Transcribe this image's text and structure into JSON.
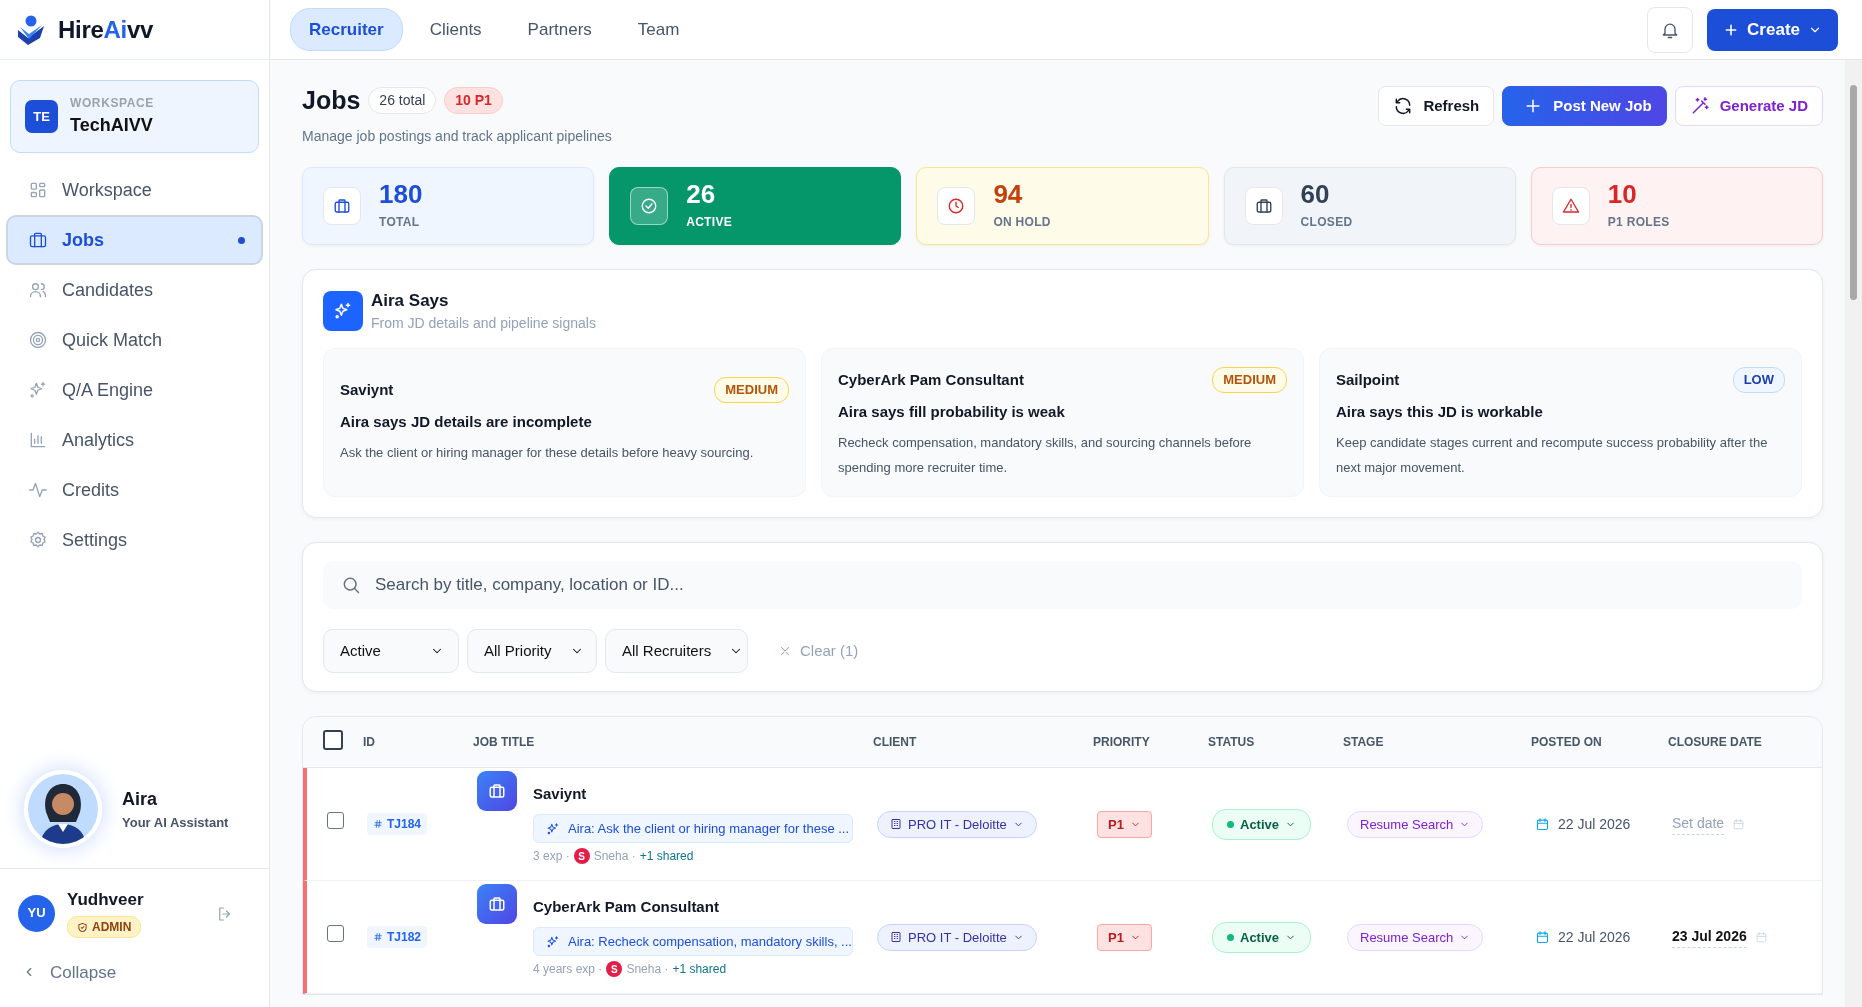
{
  "brand": {
    "parts": [
      {
        "text": "Hire",
        "accent": false
      },
      {
        "text": "Ai",
        "accent": true
      },
      {
        "text": "vv",
        "accent": false
      }
    ]
  },
  "workspace": {
    "initials": "TE",
    "label": "WORKSPACE",
    "name": "TechAIVV"
  },
  "sidebar": {
    "items": [
      {
        "label": "Workspace",
        "selected": false
      },
      {
        "label": "Jobs",
        "selected": true
      },
      {
        "label": "Candidates",
        "selected": false
      },
      {
        "label": "Quick Match",
        "selected": false
      },
      {
        "label": "Q/A Engine",
        "selected": false
      },
      {
        "label": "Analytics",
        "selected": false
      },
      {
        "label": "Credits",
        "selected": false
      },
      {
        "label": "Settings",
        "selected": false
      }
    ]
  },
  "assistant": {
    "name": "Aira",
    "subtitle": "Your AI Assistant"
  },
  "user": {
    "initials": "YU",
    "name": "Yudhveer",
    "role": "ADMIN"
  },
  "collapse": {
    "label": "Collapse"
  },
  "top_tabs": [
    {
      "label": "Recruiter",
      "selected": true
    },
    {
      "label": "Clients",
      "selected": false
    },
    {
      "label": "Partners",
      "selected": false
    },
    {
      "label": "Team",
      "selected": false
    }
  ],
  "create_button": {
    "label": "Create"
  },
  "page": {
    "title": "Jobs",
    "total_badge": "26 total",
    "p1_badge": "10 P1",
    "subtitle": "Manage job postings and track applicant pipelines",
    "actions": [
      {
        "kind": "refresh",
        "label": "Refresh"
      },
      {
        "kind": "post",
        "label": "Post New Job"
      },
      {
        "kind": "generate",
        "label": "Generate JD"
      }
    ]
  },
  "stats": [
    {
      "kind": "total",
      "value": "180",
      "label": "TOTAL"
    },
    {
      "kind": "active",
      "value": "26",
      "label": "ACTIVE"
    },
    {
      "kind": "hold",
      "value": "94",
      "label": "ON HOLD"
    },
    {
      "kind": "closed",
      "value": "60",
      "label": "CLOSED"
    },
    {
      "kind": "p1",
      "value": "10",
      "label": "P1 ROLES"
    }
  ],
  "insights": {
    "title": "Aira Says",
    "subtitle": "From JD details and pipeline signals",
    "cards": [
      {
        "job": "Saviynt",
        "severity": "MEDIUM",
        "kind": "medium",
        "headline": "Aira says JD details are incomplete",
        "detail": "Ask the client or hiring manager for these details before heavy sourcing."
      },
      {
        "job": "CyberArk Pam Consultant",
        "severity": "MEDIUM",
        "kind": "medium",
        "headline": "Aira says fill probability is weak",
        "detail": "Recheck compensation, mandatory skills, and sourcing channels before spending more recruiter time."
      },
      {
        "job": "Sailpoint",
        "severity": "LOW",
        "kind": "low",
        "headline": "Aira says this JD is workable",
        "detail": "Keep candidate stages current and recompute success probability after the next major movement."
      }
    ]
  },
  "search": {
    "placeholder": "Search by title, company, location or ID..."
  },
  "filters": [
    {
      "label": "Active"
    },
    {
      "label": "All Priority"
    },
    {
      "label": "All Recruiters"
    }
  ],
  "clear": {
    "label": "Clear (1)"
  },
  "table": {
    "select_all_checked": false,
    "columns": [
      "ID",
      "JOB TITLE",
      "CLIENT",
      "PRIORITY",
      "STATUS",
      "STAGE",
      "POSTED ON",
      "CLOSURE DATE"
    ],
    "rows": [
      {
        "checked": false,
        "flagged": true,
        "id": "TJ184",
        "title": "Saviynt",
        "hint": "Aira: Ask the client or hiring manager for these ...",
        "exp": "3 exp ·",
        "recruiter_initial": "S",
        "recruiter": "Sneha ·",
        "shared": "+1 shared",
        "client": "PRO IT - Deloitte",
        "priority": "P1",
        "status": "Active",
        "stage": "Resume Search",
        "posted": "22 Jul 2026",
        "closure": "Set date",
        "closure_set": false
      },
      {
        "checked": false,
        "flagged": true,
        "id": "TJ182",
        "title": "CyberArk Pam Consultant",
        "hint": "Aira: Recheck compensation, mandatory skills, ...",
        "exp": "4 years exp ·",
        "recruiter_initial": "S",
        "recruiter": "Sneha ·",
        "shared": "+1 shared",
        "client": "PRO IT - Deloitte",
        "priority": "P1",
        "status": "Active",
        "stage": "Resume Search",
        "posted": "22 Jul 2026",
        "closure": "23 Jul 2026",
        "closure_set": true
      }
    ]
  }
}
